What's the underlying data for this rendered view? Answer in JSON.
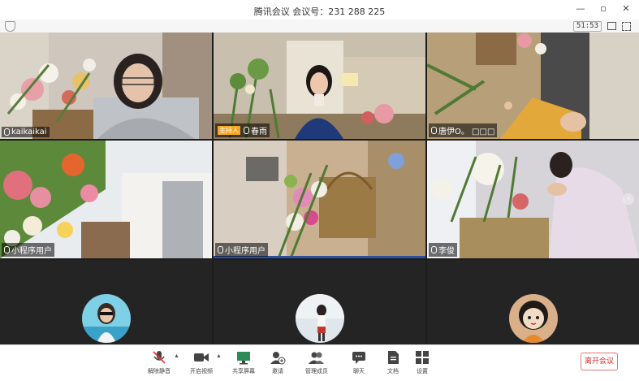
{
  "title_bar": {
    "title": "腾讯会议 会议号：231 288 225",
    "window_controls": [
      "—",
      "▫",
      "✕"
    ]
  },
  "sub_bar": {
    "timer": "51:53"
  },
  "participants": [
    {
      "name": "kaikaikai",
      "host": false
    },
    {
      "name": "春雨",
      "host": true,
      "host_badge": "主持人"
    },
    {
      "name": "唐伊O。 □□□",
      "host": false
    },
    {
      "name": "小程序用户",
      "host": false
    },
    {
      "name": "小程序用户",
      "host": false
    },
    {
      "name": "李俊",
      "host": false
    }
  ],
  "toolbar": {
    "items": [
      {
        "label": "解除静音",
        "icon": "muted-mic-icon"
      },
      {
        "label": "开启视频",
        "icon": "video-icon"
      },
      {
        "label": "共享屏幕",
        "icon": "share-screen-icon"
      },
      {
        "label": "邀请",
        "icon": "invite-icon"
      },
      {
        "label": "管理成员",
        "icon": "members-icon"
      },
      {
        "label": "聊天",
        "icon": "chat-icon"
      },
      {
        "label": "文档",
        "icon": "document-icon"
      },
      {
        "label": "设置",
        "icon": "settings-icon"
      }
    ],
    "leave_label": "离开会议",
    "leave_color": "#d32f2f"
  }
}
